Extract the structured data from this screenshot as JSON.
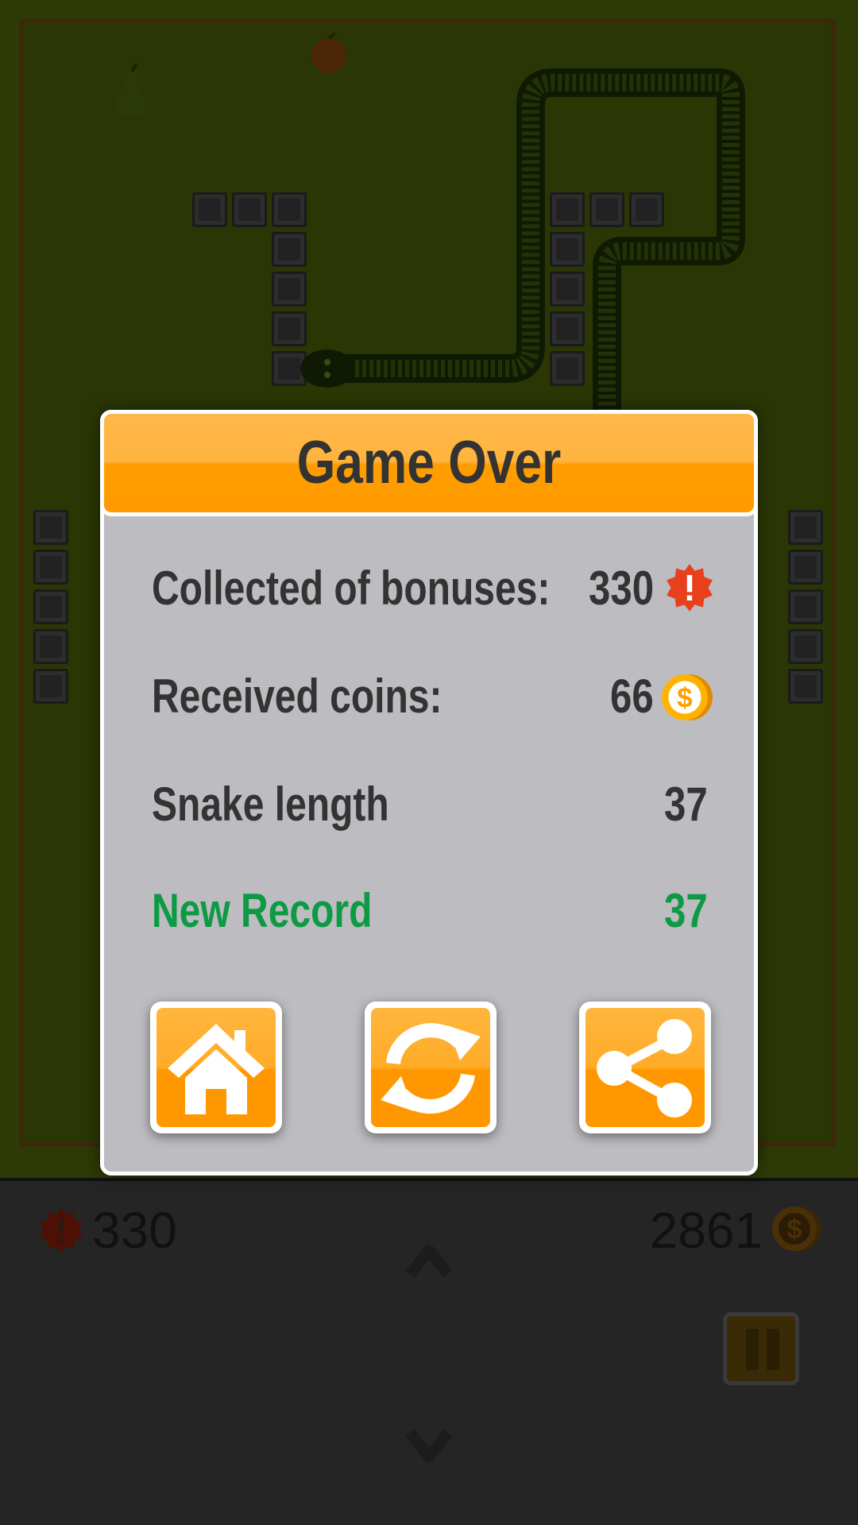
{
  "dialog": {
    "title": "Game Over",
    "rows": [
      {
        "label": "Collected of bonuses:",
        "value": "330",
        "icon": "bonus-icon"
      },
      {
        "label": "Received coins:",
        "value": "66",
        "icon": "coin-icon"
      },
      {
        "label": "Snake length",
        "value": "37"
      },
      {
        "label": "New Record",
        "value": "37",
        "color": "#0c9a44"
      }
    ],
    "buttons": [
      {
        "name": "home-button",
        "icon": "home-icon"
      },
      {
        "name": "restart-button",
        "icon": "restart-icon"
      },
      {
        "name": "share-button",
        "icon": "share-icon"
      }
    ]
  },
  "hud": {
    "bonus_count": "330",
    "coin_count": "2861",
    "up_icon": "chevron-up-icon",
    "down_icon": "chevron-down-icon",
    "pause_icon": "pause-icon"
  },
  "colors": {
    "accent_orange": "#ff9c00",
    "record_green": "#0c9a44",
    "dialog_bg": "#bdbcc0"
  }
}
